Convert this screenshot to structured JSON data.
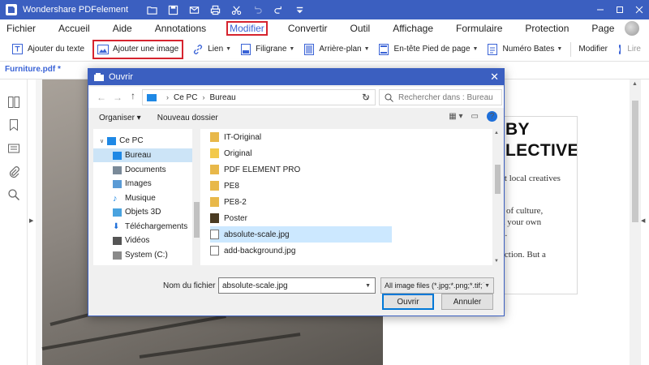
{
  "app": {
    "title": "Wondershare PDFelement",
    "colors": {
      "accent": "#3b5fc0",
      "highlight": "#d6242f",
      "link": "#3a63d6"
    }
  },
  "quick_access": [
    "open-folder-icon",
    "save-icon",
    "email-icon",
    "print-icon",
    "cut-icon",
    "undo-icon",
    "redo-icon",
    "customize-icon"
  ],
  "menu": {
    "items": [
      "Fichier",
      "Accueil",
      "Aide",
      "Annotations",
      "Modifier",
      "Convertir",
      "Outil",
      "Affichage",
      "Formulaire",
      "Protection",
      "Page"
    ],
    "active": "Modifier"
  },
  "toolbar": {
    "add_text": "Ajouter du texte",
    "add_image": "Ajouter une image",
    "link": "Lien",
    "watermark": "Filigrane",
    "background": "Arrière-plan",
    "header": "En-tête",
    "footer": "Pied de page",
    "bates": "Numéro Bates",
    "edit_mode": "Modifier",
    "read_mode": "Lire"
  },
  "document": {
    "tab": "Furniture.pdf *",
    "heading_line1": "BY",
    "heading_line2": "LECTIVE.",
    "body": [
      "et local creatives",
      "s of culture,",
      "d your own",
      "n.",
      "ection. But a"
    ]
  },
  "dialog": {
    "title": "Ouvrir",
    "breadcrumb": [
      "Ce PC",
      "Bureau"
    ],
    "search_placeholder": "Rechercher dans : Bureau",
    "organize": "Organiser",
    "new_folder": "Nouveau dossier",
    "nav": [
      {
        "label": "Ce PC",
        "icon": "pc-icon"
      },
      {
        "label": "Bureau",
        "icon": "desktop-icon",
        "selected": true
      },
      {
        "label": "Documents",
        "icon": "documents-icon"
      },
      {
        "label": "Images",
        "icon": "images-icon"
      },
      {
        "label": "Musique",
        "icon": "music-icon"
      },
      {
        "label": "Objets 3D",
        "icon": "objects3d-icon"
      },
      {
        "label": "Téléchargements",
        "icon": "downloads-icon"
      },
      {
        "label": "Vidéos",
        "icon": "videos-icon"
      },
      {
        "label": "System (C:)",
        "icon": "drive-icon"
      }
    ],
    "files": [
      {
        "name": "IT-Original",
        "type": "folder"
      },
      {
        "name": "Original",
        "type": "folder"
      },
      {
        "name": "PDF ELEMENT PRO",
        "type": "folder"
      },
      {
        "name": "PE8",
        "type": "folder"
      },
      {
        "name": "PE8-2",
        "type": "folder"
      },
      {
        "name": "Poster",
        "type": "folder"
      },
      {
        "name": "absolute-scale.jpg",
        "type": "image",
        "selected": true
      },
      {
        "name": "add-background.jpg",
        "type": "image"
      }
    ],
    "filename_label": "Nom du fichier :",
    "filename_value": "absolute-scale.jpg",
    "filetype": "All image files (*.jpg;*.png;*.tif;*",
    "open_button": "Ouvrir",
    "cancel_button": "Annuler"
  }
}
